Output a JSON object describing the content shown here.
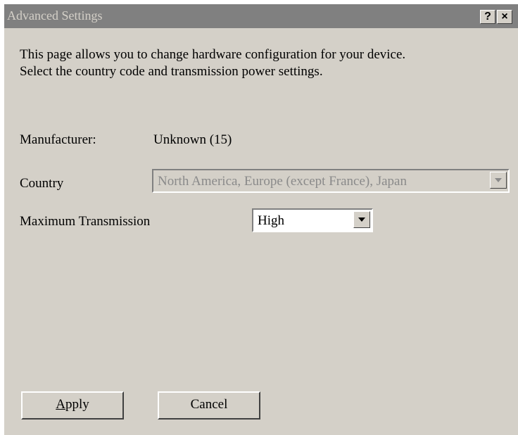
{
  "window": {
    "title": "Advanced Settings",
    "help_glyph": "?",
    "close_glyph": "×"
  },
  "description": {
    "line1": "This page allows you to change hardware configuration for your device.",
    "line2": "Select the country code and transmission power settings."
  },
  "manufacturer": {
    "label": "Manufacturer:",
    "value": "Unknown (15)"
  },
  "country": {
    "label": "Country",
    "selected": "North America, Europe (except France), Japan",
    "enabled": false
  },
  "transmission": {
    "label": "Maximum Transmission",
    "selected": "High"
  },
  "buttons": {
    "apply_accel": "A",
    "apply_rest": "pply",
    "cancel": "Cancel"
  },
  "colors": {
    "dialog_bg": "#d4d0c8",
    "titlebar_bg": "#808080",
    "disabled_text": "#8a8a8a"
  },
  "icons": [
    "help-icon",
    "close-icon",
    "dropdown-arrow-icon"
  ]
}
